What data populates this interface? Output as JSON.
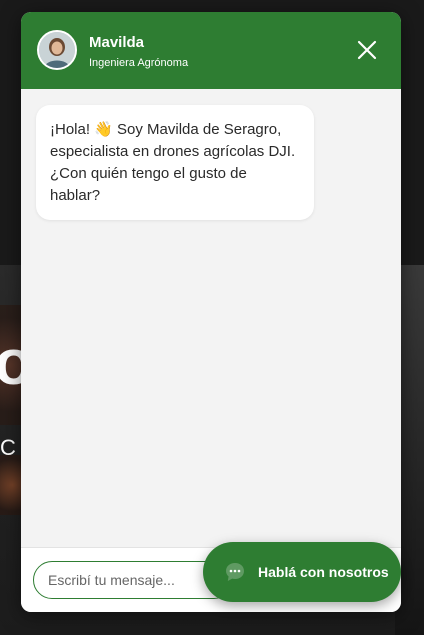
{
  "colors": {
    "brand_green": "#2e7d32",
    "chat_background": "#f3f3f3",
    "bubble_background": "#ffffff",
    "page_background": "#1d1d1d"
  },
  "background_page": {
    "hero_glyph_large": "o",
    "hero_glyph_small": "C"
  },
  "chat": {
    "header": {
      "agent_name": "Mavilda",
      "agent_role": "Ingeniera Agrónoma",
      "avatar_icon": "agent-avatar",
      "close_icon": "close-icon"
    },
    "messages": [
      {
        "sender": "Mavilda",
        "text": "¡Hola! 👋 Soy Mavilda de Seragro, especialista en drones agrícolas DJI. ¿Con quién tengo el gusto de hablar?"
      }
    ],
    "input": {
      "placeholder": "Escribí tu mensaje...",
      "value": ""
    }
  },
  "cta": {
    "label": "Hablá con nosotros",
    "icon": "chat-bubble-icon"
  }
}
